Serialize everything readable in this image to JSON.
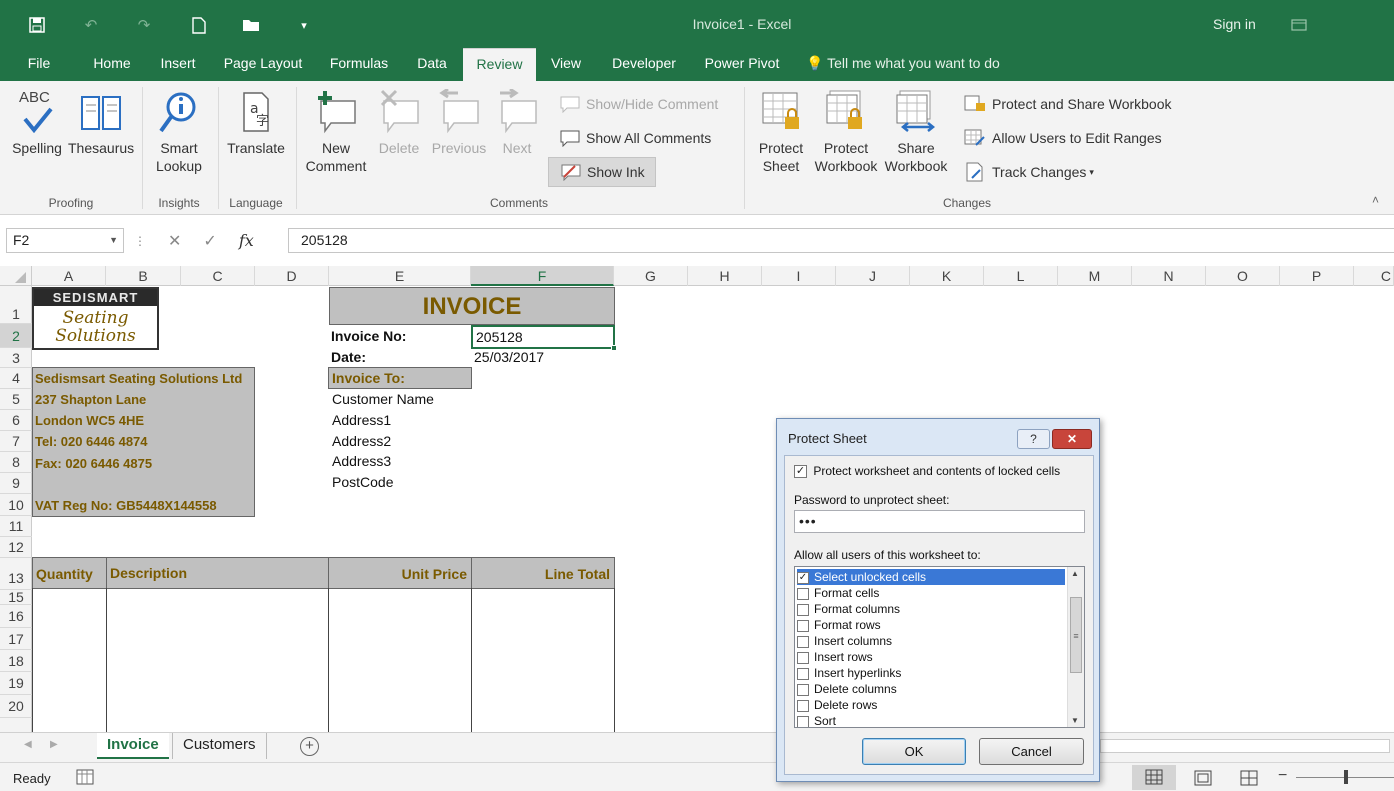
{
  "titlebar": {
    "doc_title": "Invoice1 - Excel",
    "signin": "Sign in",
    "qat_icons": [
      "save-icon",
      "undo-icon",
      "redo-icon",
      "new-file-icon",
      "open-folder-icon",
      "customize-qat-icon"
    ]
  },
  "tabs": {
    "file": "File",
    "home": "Home",
    "insert": "Insert",
    "page_layout": "Page Layout",
    "formulas": "Formulas",
    "data": "Data",
    "review": "Review",
    "view": "View",
    "developer": "Developer",
    "power_pivot": "Power Pivot",
    "tellme": "Tell me what you want to do"
  },
  "ribbon": {
    "spelling": "Spelling",
    "spelling_abc": "ABC",
    "thesaurus": "Thesaurus",
    "smart": "Smart",
    "lookup": "Lookup",
    "translate": "Translate",
    "new": "New",
    "comment": "Comment",
    "delete": "Delete",
    "previous": "Previous",
    "next": "Next",
    "show_hide_comment": "Show/Hide Comment",
    "show_all_comments": "Show All Comments",
    "show_ink": "Show Ink",
    "protect": "Protect",
    "sheet": "Sheet",
    "workbook": "Workbook",
    "share": "Share",
    "protect_share": "Protect and Share Workbook",
    "allow_users": "Allow Users to Edit Ranges",
    "track_changes": "Track Changes",
    "groups": {
      "proofing": "Proofing",
      "insights": "Insights",
      "language": "Language",
      "comments": "Comments",
      "changes": "Changes"
    }
  },
  "formula_bar": {
    "name_box": "F2",
    "fx": "fx",
    "value": "205128"
  },
  "columns": [
    "A",
    "B",
    "C",
    "D",
    "E",
    "F",
    "G",
    "H",
    "I",
    "J",
    "K",
    "L",
    "M",
    "N",
    "O",
    "P",
    "C"
  ],
  "rows": [
    "1",
    "2",
    "3",
    "4",
    "5",
    "6",
    "7",
    "8",
    "9",
    "10",
    "11",
    "12",
    "13",
    "15",
    "16",
    "17",
    "18",
    "19",
    "20"
  ],
  "sheet": {
    "logo_top": "SEDISMART",
    "logo_line1": "Seating",
    "logo_line2": "Solutions",
    "invoice_title": "INVOICE",
    "invoice_no_label": "Invoice No:",
    "invoice_no": "205128",
    "date_label": "Date:",
    "date": "25/03/2017",
    "invoice_to": "Invoice To:",
    "customer": [
      "Customer Name",
      "Address1",
      "Address2",
      "Address3",
      "PostCode"
    ],
    "company": [
      "Sedismsart Seating Solutions Ltd",
      "237 Shapton Lane",
      "London WC5 4HE",
      "Tel: 020 6446 4874",
      "Fax: 020 6446 4875",
      "",
      "VAT Reg No: GB5448X144558"
    ],
    "table_headers": {
      "quantity": "Quantity",
      "description": "Description",
      "unit_price": "Unit Price",
      "line_total": "Line Total"
    }
  },
  "sheet_tabs": [
    "Invoice",
    "Customers"
  ],
  "status": {
    "ready": "Ready"
  },
  "dialog": {
    "title": "Protect Sheet",
    "help": "?",
    "close": "✕",
    "protect_label": "Protect worksheet and contents of locked cells",
    "password_label": "Password to unprotect sheet:",
    "password_value": "•••",
    "allow_label": "Allow all users of this worksheet to:",
    "permissions": [
      "Select unlocked cells",
      "Format cells",
      "Format columns",
      "Format rows",
      "Insert columns",
      "Insert rows",
      "Insert hyperlinks",
      "Delete columns",
      "Delete rows",
      "Sort"
    ],
    "ok": "OK",
    "cancel": "Cancel"
  },
  "colors": {
    "excel_green": "#217346",
    "selection_blue": "#3a78d6",
    "header_gold": "#7a5a00"
  }
}
